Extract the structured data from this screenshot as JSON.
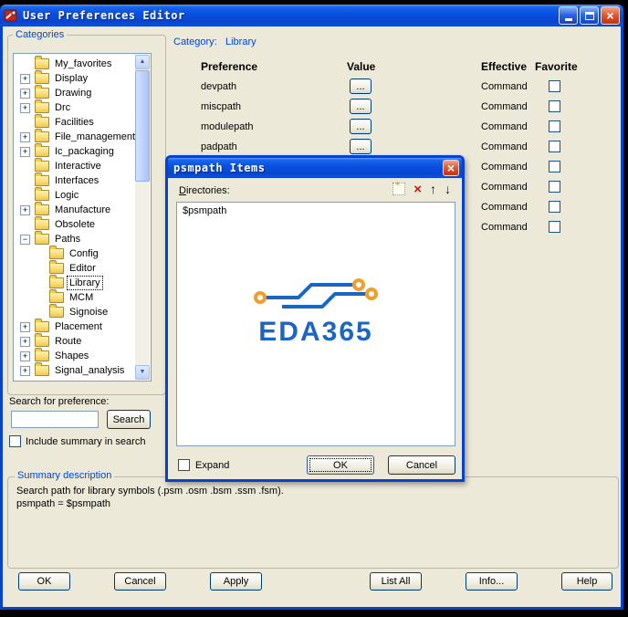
{
  "colors": {
    "titlebar_blue": "#0842cb",
    "window_bg": "#ece9d8",
    "group_label_blue": "#0046d5",
    "logo_blue": "#1a66c2",
    "logo_orange": "#f09e2d",
    "close_red": "#cc3612"
  },
  "icons": {
    "close": "×",
    "scroll_up": "▲",
    "scroll_down": "▼",
    "expander_plus": "+",
    "expander_minus": "−",
    "delete": "×",
    "move_up": "↑",
    "move_down": "↓"
  },
  "window": {
    "title": "User Preferences Editor"
  },
  "categories": {
    "label": "Categories",
    "tree": [
      {
        "label": "My_favorites",
        "level": 0,
        "expander": "none",
        "selected": false
      },
      {
        "label": "Display",
        "level": 0,
        "expander": "plus",
        "selected": false
      },
      {
        "label": "Drawing",
        "level": 0,
        "expander": "plus",
        "selected": false
      },
      {
        "label": "Drc",
        "level": 0,
        "expander": "plus",
        "selected": false
      },
      {
        "label": "Facilities",
        "level": 0,
        "expander": "none",
        "selected": false
      },
      {
        "label": "File_management",
        "level": 0,
        "expander": "plus",
        "selected": false
      },
      {
        "label": "Ic_packaging",
        "level": 0,
        "expander": "plus",
        "selected": false
      },
      {
        "label": "Interactive",
        "level": 0,
        "expander": "none",
        "selected": false
      },
      {
        "label": "Interfaces",
        "level": 0,
        "expander": "none",
        "selected": false
      },
      {
        "label": "Logic",
        "level": 0,
        "expander": "none",
        "selected": false
      },
      {
        "label": "Manufacture",
        "level": 0,
        "expander": "plus",
        "selected": false
      },
      {
        "label": "Obsolete",
        "level": 0,
        "expander": "none",
        "selected": false
      },
      {
        "label": "Paths",
        "level": 0,
        "expander": "minus",
        "selected": false
      },
      {
        "label": "Config",
        "level": 1,
        "expander": "none",
        "selected": false
      },
      {
        "label": "Editor",
        "level": 1,
        "expander": "none",
        "selected": false
      },
      {
        "label": "Library",
        "level": 1,
        "expander": "none",
        "selected": true
      },
      {
        "label": "MCM",
        "level": 1,
        "expander": "none",
        "selected": false
      },
      {
        "label": "Signoise",
        "level": 1,
        "expander": "none",
        "selected": false
      },
      {
        "label": "Placement",
        "level": 0,
        "expander": "plus",
        "selected": false
      },
      {
        "label": "Route",
        "level": 0,
        "expander": "plus",
        "selected": false
      },
      {
        "label": "Shapes",
        "level": 0,
        "expander": "plus",
        "selected": false
      },
      {
        "label": "Signal_analysis",
        "level": 0,
        "expander": "plus",
        "selected": false
      }
    ]
  },
  "search": {
    "label": "Search for preference:",
    "input_value": "",
    "button": "Search",
    "include_label": "Include summary in search",
    "include_checked": false
  },
  "prefs": {
    "category_label": "Category:",
    "category_value": "Library",
    "columns": [
      "Preference",
      "Value",
      "Effective",
      "Favorite"
    ],
    "value_button": "...",
    "rows": [
      {
        "name": "devpath",
        "effective": "Command",
        "favorite": false
      },
      {
        "name": "miscpath",
        "effective": "Command",
        "favorite": false
      },
      {
        "name": "modulepath",
        "effective": "Command",
        "favorite": false
      },
      {
        "name": "padpath",
        "effective": "Command",
        "favorite": false
      },
      {
        "name": "",
        "effective": "Command",
        "favorite": false
      },
      {
        "name": "",
        "effective": "Command",
        "favorite": false
      },
      {
        "name": "",
        "effective": "Command",
        "favorite": false
      },
      {
        "name": "",
        "effective": "Command",
        "favorite": false
      }
    ]
  },
  "modal": {
    "title": "psmpath Items",
    "directories_accel": "D",
    "directories_rest": "irectories:",
    "list_items": [
      "$psmpath"
    ],
    "logo_text": "EDA365",
    "expand_label": "Expand",
    "expand_checked": false,
    "ok_label": "OK",
    "cancel_label": "Cancel"
  },
  "summary": {
    "label": "Summary description",
    "lines": [
      "Search path for library symbols (.psm .osm .bsm .ssm .fsm).",
      "psmpath = $psmpath"
    ]
  },
  "footer": {
    "buttons": [
      "OK",
      "Cancel",
      "Apply",
      "List All",
      "Info...",
      "Help"
    ]
  }
}
